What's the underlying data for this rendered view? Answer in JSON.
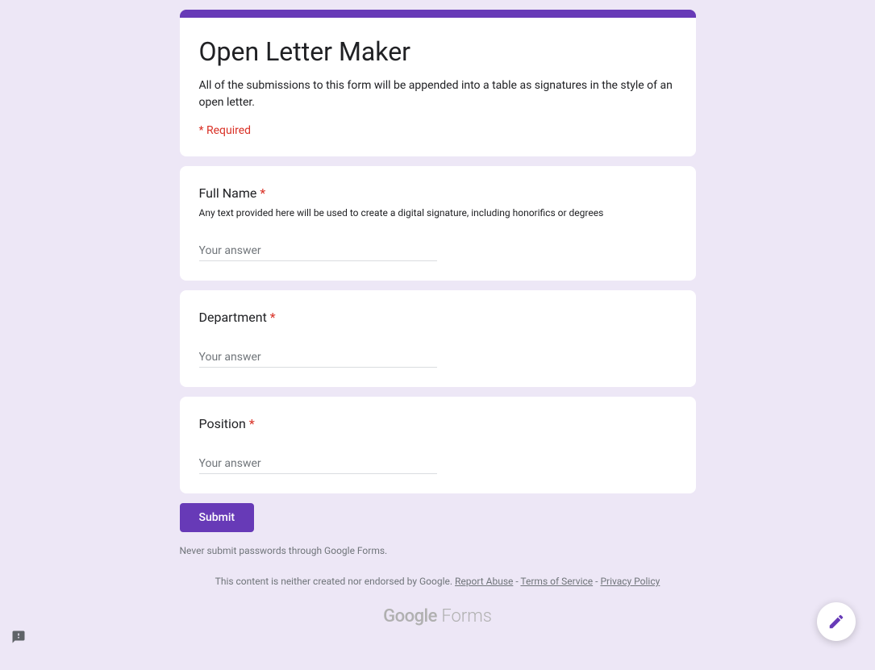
{
  "header": {
    "title": "Open Letter Maker",
    "description": "All of the submissions to this form will be appended into a table as signatures in the style of an open letter.",
    "required_note": "* Required"
  },
  "questions": [
    {
      "label": "Full Name",
      "required": true,
      "help": "Any text provided here will be used to create a digital signature, including honorifics or degrees",
      "placeholder": "Your answer"
    },
    {
      "label": "Department",
      "required": true,
      "help": "",
      "placeholder": "Your answer"
    },
    {
      "label": "Position",
      "required": true,
      "help": "",
      "placeholder": "Your answer"
    }
  ],
  "submit": {
    "label": "Submit"
  },
  "footer": {
    "password_warning": "Never submit passwords through Google Forms.",
    "disclaimer_text": "This content is neither created nor endorsed by Google. ",
    "report_abuse": "Report Abuse",
    "separator": " - ",
    "terms": "Terms of Service",
    "privacy": "Privacy Policy",
    "logo_google": "Google",
    "logo_forms": " Forms"
  },
  "asterisk": " *"
}
